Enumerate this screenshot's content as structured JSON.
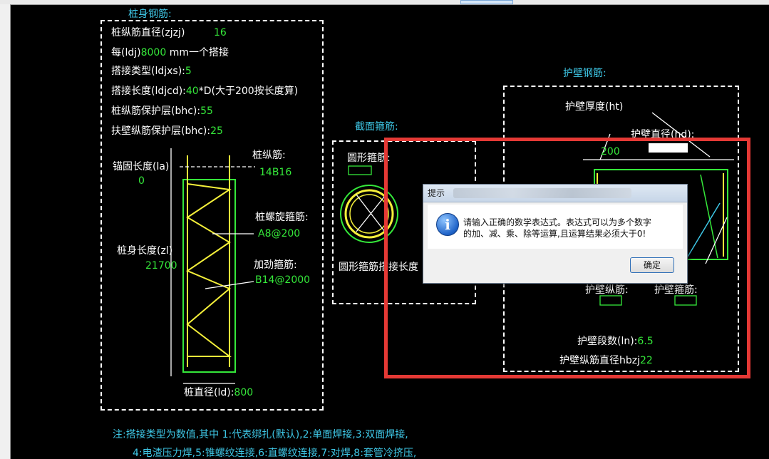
{
  "pile": {
    "section_title": "桩身钢筋:",
    "params": [
      {
        "label": "桩纵筋直径(zjzj)",
        "value": "16"
      },
      {
        "label": "每(ldj)",
        "value": "8000",
        "suffix": "mm一个搭接"
      },
      {
        "label": "搭接类型(ldjxs):",
        "value": "5"
      },
      {
        "label": "搭接长度(ldjcd):",
        "value": "40",
        "suffix": "*D(大于200按长度算)"
      },
      {
        "label": "桩纵筋保护层(bhc):",
        "value": "55"
      },
      {
        "label": "扶壁纵筋保护层(bhc):",
        "value": "25"
      }
    ],
    "anchor_label": "锚固长度(la)",
    "anchor_value": "0",
    "longbar_label": "桩纵筋:",
    "longbar_value": "14B16",
    "spiral_label": "桩螺旋箍筋:",
    "spiral_value": "A8@200",
    "stiff_label": "加劲箍筋:",
    "stiff_value": "B14@2000",
    "length_label": "桩身长度(zl)",
    "length_value": "21700",
    "diameter_label": "桩直径(ld):",
    "diameter_value": "800"
  },
  "section": {
    "title": "截面箍筋:",
    "circle_label": "圆形箍筋:",
    "lap_label": "圆形箍筋搭接长度"
  },
  "wall": {
    "title": "护壁钢筋:",
    "thickness_label": "护壁厚度(ht)",
    "thickness_value": "200",
    "diameter_label": "护壁直径(hd):",
    "long_label": "护壁纵筋:",
    "stirrup_label": "护壁箍筋:",
    "segments_label": "护壁段数(ln):",
    "segments_value": "6.5",
    "longdia_label": "护壁纵筋直径hbzj",
    "longdia_value": "22"
  },
  "notes": {
    "line1": "注:搭接类型为数值,其中 1:代表绑扎(默认),2:单面焊接,3:双面焊接,",
    "line2": "4:电渣压力焊,5:锥螺纹连接,6:直螺纹连接,7:对焊,8:套管冷挤压,"
  },
  "dialog": {
    "title": "提示",
    "message_line1": "请输入正确的数学表达式。表达式可以为多个数字",
    "message_line2": "的加、减、乘、除等运算,且运算结果必须大于0!",
    "ok_label": "确定",
    "icon": "info-icon"
  },
  "colors": {
    "value_green": "#35e83a",
    "title_cyan": "#3ec7e6",
    "rebar_yellow": "#f5f03a",
    "highlight_red": "#e53935"
  }
}
